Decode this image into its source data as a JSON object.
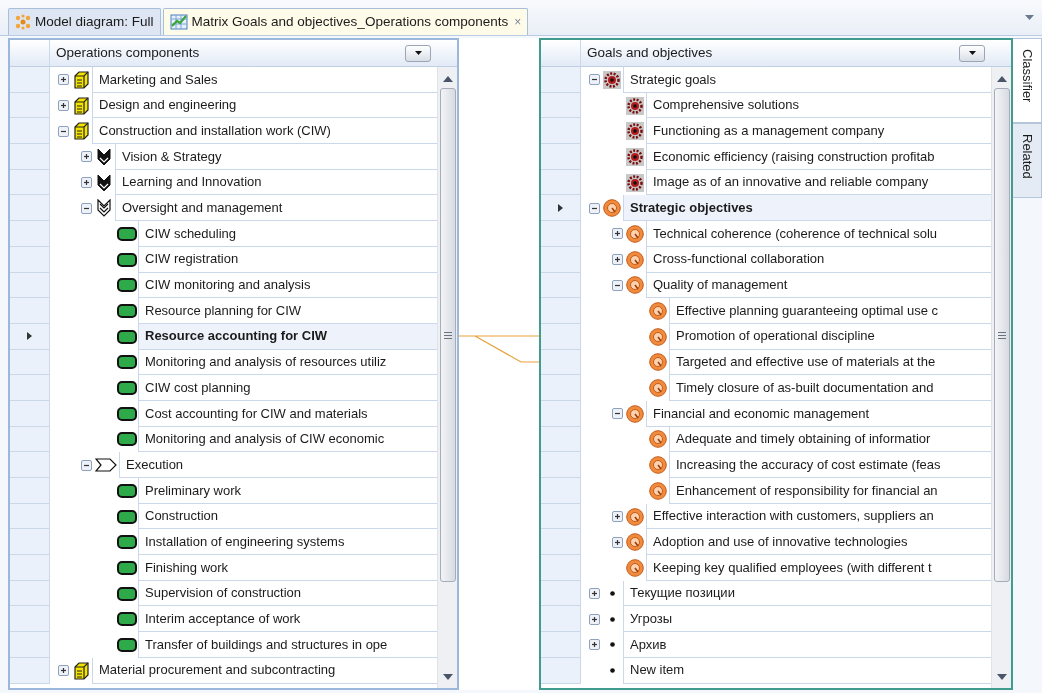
{
  "tabs": [
    {
      "label": "Model diagram: Full",
      "kind": "diagram",
      "selected": false
    },
    {
      "label": "Matrix Goals and objectives_Operations components",
      "kind": "matrix",
      "selected": true,
      "close": "×"
    }
  ],
  "panels": [
    {
      "header": "Operations components",
      "focused": false,
      "items": [
        {
          "label": "Marketing and Sales",
          "kind": "group",
          "expanded": false,
          "selected": false
        },
        {
          "label": "Design and engineering",
          "kind": "group",
          "expanded": false,
          "selected": false
        },
        {
          "label": "Construction and installation work (CIW)",
          "kind": "group",
          "expanded": true,
          "selected": false,
          "children": [
            {
              "label": "Vision & Strategy",
              "kind": "chevron",
              "expanded": false,
              "selected": false
            },
            {
              "label": "Learning and Innovation",
              "kind": "chevron",
              "expanded": false,
              "selected": false
            },
            {
              "label": "Oversight and management",
              "kind": "double-chevron",
              "expanded": true,
              "selected": false,
              "children": [
                {
                  "label": "CIW scheduling",
                  "kind": "function",
                  "selected": false
                },
                {
                  "label": "CIW registration",
                  "kind": "function",
                  "selected": false
                },
                {
                  "label": "CIW monitoring and analysis",
                  "kind": "function",
                  "selected": false
                },
                {
                  "label": "Resource planning for CIW",
                  "kind": "function",
                  "selected": false
                },
                {
                  "label": "Resource accounting for CIW",
                  "kind": "function",
                  "selected": true
                },
                {
                  "label": "Monitoring and analysis of resources utiliz",
                  "kind": "function",
                  "selected": false
                },
                {
                  "label": "CIW cost planning",
                  "kind": "function",
                  "selected": false
                },
                {
                  "label": "Cost accounting for CIW and materials",
                  "kind": "function",
                  "selected": false
                },
                {
                  "label": "Monitoring and analysis of CIW economic",
                  "kind": "function",
                  "selected": false
                }
              ]
            },
            {
              "label": "Execution",
              "kind": "step",
              "expanded": true,
              "selected": false,
              "children": [
                {
                  "label": "Preliminary work",
                  "kind": "function",
                  "selected": false
                },
                {
                  "label": "Construction",
                  "kind": "function",
                  "selected": false
                },
                {
                  "label": "Installation of engineering systems",
                  "kind": "function",
                  "selected": false
                },
                {
                  "label": "Finishing work",
                  "kind": "function",
                  "selected": false
                },
                {
                  "label": "Supervision of construction",
                  "kind": "function",
                  "selected": false
                },
                {
                  "label": "Interim acceptance of work",
                  "kind": "function",
                  "selected": false
                },
                {
                  "label": "Transfer of buildings and structures in ope",
                  "kind": "function",
                  "selected": false
                }
              ]
            }
          ]
        },
        {
          "label": "Material procurement and subcontracting",
          "kind": "group",
          "expanded": false,
          "selected": false
        }
      ]
    },
    {
      "header": "Goals and objectives",
      "focused": true,
      "items": [
        {
          "label": "Strategic goals",
          "kind": "goal",
          "expanded": true,
          "selected": false,
          "children": [
            {
              "label": "Comprehensive solutions",
              "kind": "goal",
              "selected": false
            },
            {
              "label": "Functioning as a management company",
              "kind": "goal",
              "selected": false
            },
            {
              "label": "Economic efficiency (raising construction profitab",
              "kind": "goal",
              "selected": false
            },
            {
              "label": "Image as of an innovative and reliable company",
              "kind": "goal",
              "selected": false
            }
          ]
        },
        {
          "label": "Strategic objectives",
          "kind": "objective",
          "expanded": true,
          "selected": true,
          "children": [
            {
              "label": "Technical coherence (coherence of technical solu",
              "kind": "objective",
              "expanded": false,
              "selected": false
            },
            {
              "label": "Cross-functional collaboration",
              "kind": "objective",
              "expanded": false,
              "selected": false
            },
            {
              "label": "Quality of management",
              "kind": "objective",
              "expanded": true,
              "selected": false,
              "children": [
                {
                  "label": "Effective planning guaranteeing optimal use c",
                  "kind": "objective",
                  "selected": false
                },
                {
                  "label": "Promotion of operational discipline",
                  "kind": "objective",
                  "selected": false
                },
                {
                  "label": "Targeted and effective use of materials at the",
                  "kind": "objective",
                  "selected": false
                },
                {
                  "label": "Timely closure of as-built documentation and",
                  "kind": "objective",
                  "selected": false
                }
              ]
            },
            {
              "label": "Financial and economic management",
              "kind": "objective",
              "expanded": true,
              "selected": false,
              "children": [
                {
                  "label": "Adequate and timely obtaining of informatior",
                  "kind": "objective",
                  "selected": false
                },
                {
                  "label": "Increasing the accuracy of cost estimate (feas",
                  "kind": "objective",
                  "selected": false
                },
                {
                  "label": "Enhancement of responsibility for financial an",
                  "kind": "objective",
                  "selected": false
                }
              ]
            },
            {
              "label": "Effective interaction with customers, suppliers an",
              "kind": "objective",
              "expanded": false,
              "selected": false
            },
            {
              "label": "Adoption and use of innovative technologies",
              "kind": "objective",
              "expanded": false,
              "selected": false
            },
            {
              "label": "Keeping key qualified employees (with different t",
              "kind": "objective",
              "selected": false
            }
          ]
        },
        {
          "label": "Текущие позиции",
          "kind": "bullet",
          "expanded": false,
          "selected": false
        },
        {
          "label": "Угрозы",
          "kind": "bullet",
          "expanded": false,
          "selected": false
        },
        {
          "label": "Архив",
          "kind": "bullet",
          "expanded": false,
          "selected": false
        },
        {
          "label": "New item",
          "kind": "bullet",
          "selected": false
        }
      ]
    }
  ],
  "side_tabs": [
    {
      "label": "Classifier",
      "selected": true
    },
    {
      "label": "Related",
      "selected": false
    }
  ]
}
